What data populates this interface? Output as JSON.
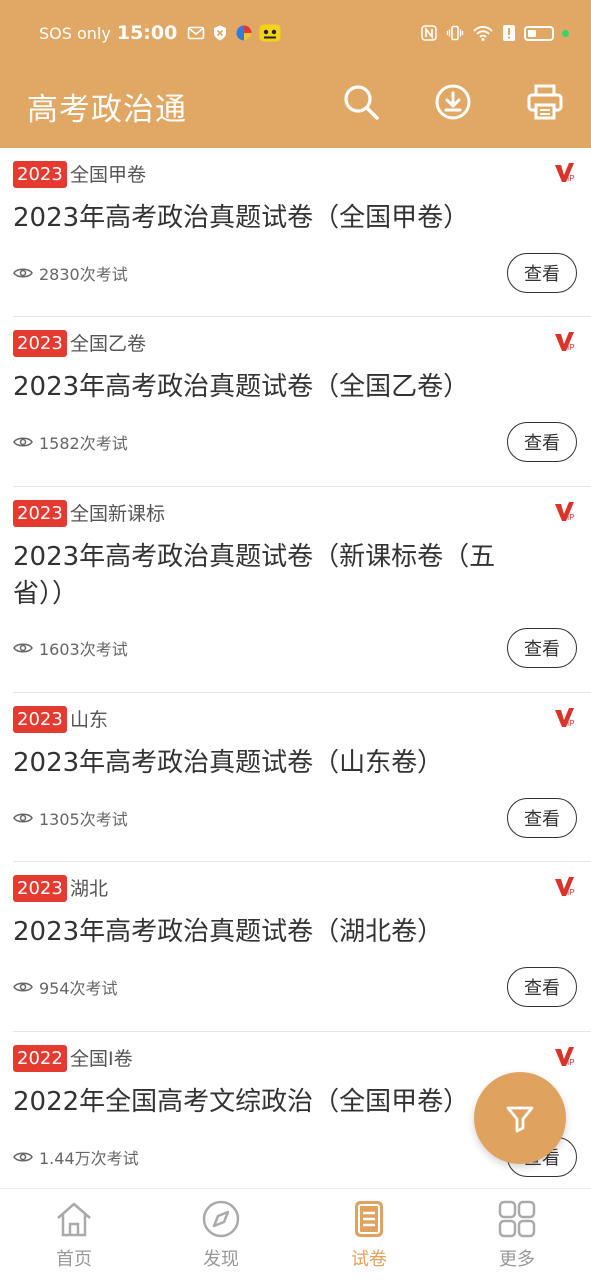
{
  "status_bar": {
    "carrier": "SOS only",
    "time": "15:00"
  },
  "header": {
    "title": "高考政治通",
    "icons": [
      "search-icon",
      "download-icon",
      "print-icon"
    ]
  },
  "colors": {
    "primary": "#e1a765",
    "badge_red": "#e53a2f",
    "vip_red": "#d8342b",
    "active_nav": "#e0a35f"
  },
  "list": {
    "items": [
      {
        "year": "2023",
        "region": "全国甲卷",
        "title": "2023年高考政治真题试卷（全国甲卷）",
        "stats": "2830次考试",
        "button": "查看"
      },
      {
        "year": "2023",
        "region": "全国乙卷",
        "title": "2023年高考政治真题试卷（全国乙卷）",
        "stats": "1582次考试",
        "button": "查看"
      },
      {
        "year": "2023",
        "region": "全国新课标",
        "title": "2023年高考政治真题试卷（新课标卷（五省））",
        "stats": "1603次考试",
        "button": "查看"
      },
      {
        "year": "2023",
        "region": "山东",
        "title": "2023年高考政治真题试卷（山东卷）",
        "stats": "1305次考试",
        "button": "查看"
      },
      {
        "year": "2023",
        "region": "湖北",
        "title": "2023年高考政治真题试卷（湖北卷）",
        "stats": "954次考试",
        "button": "查看"
      },
      {
        "year": "2022",
        "region": "全国I卷",
        "title": "2022年全国高考文综政治（全国甲卷）",
        "stats": "1.44万次考试",
        "button": "查看"
      }
    ]
  },
  "fab": {
    "icon": "filter-icon"
  },
  "bottom_nav": {
    "active_index": 2,
    "items": [
      {
        "label": "首页",
        "icon": "home-icon"
      },
      {
        "label": "发现",
        "icon": "compass-icon"
      },
      {
        "label": "试卷",
        "icon": "exam-paper-icon"
      },
      {
        "label": "更多",
        "icon": "grid-icon"
      }
    ]
  }
}
